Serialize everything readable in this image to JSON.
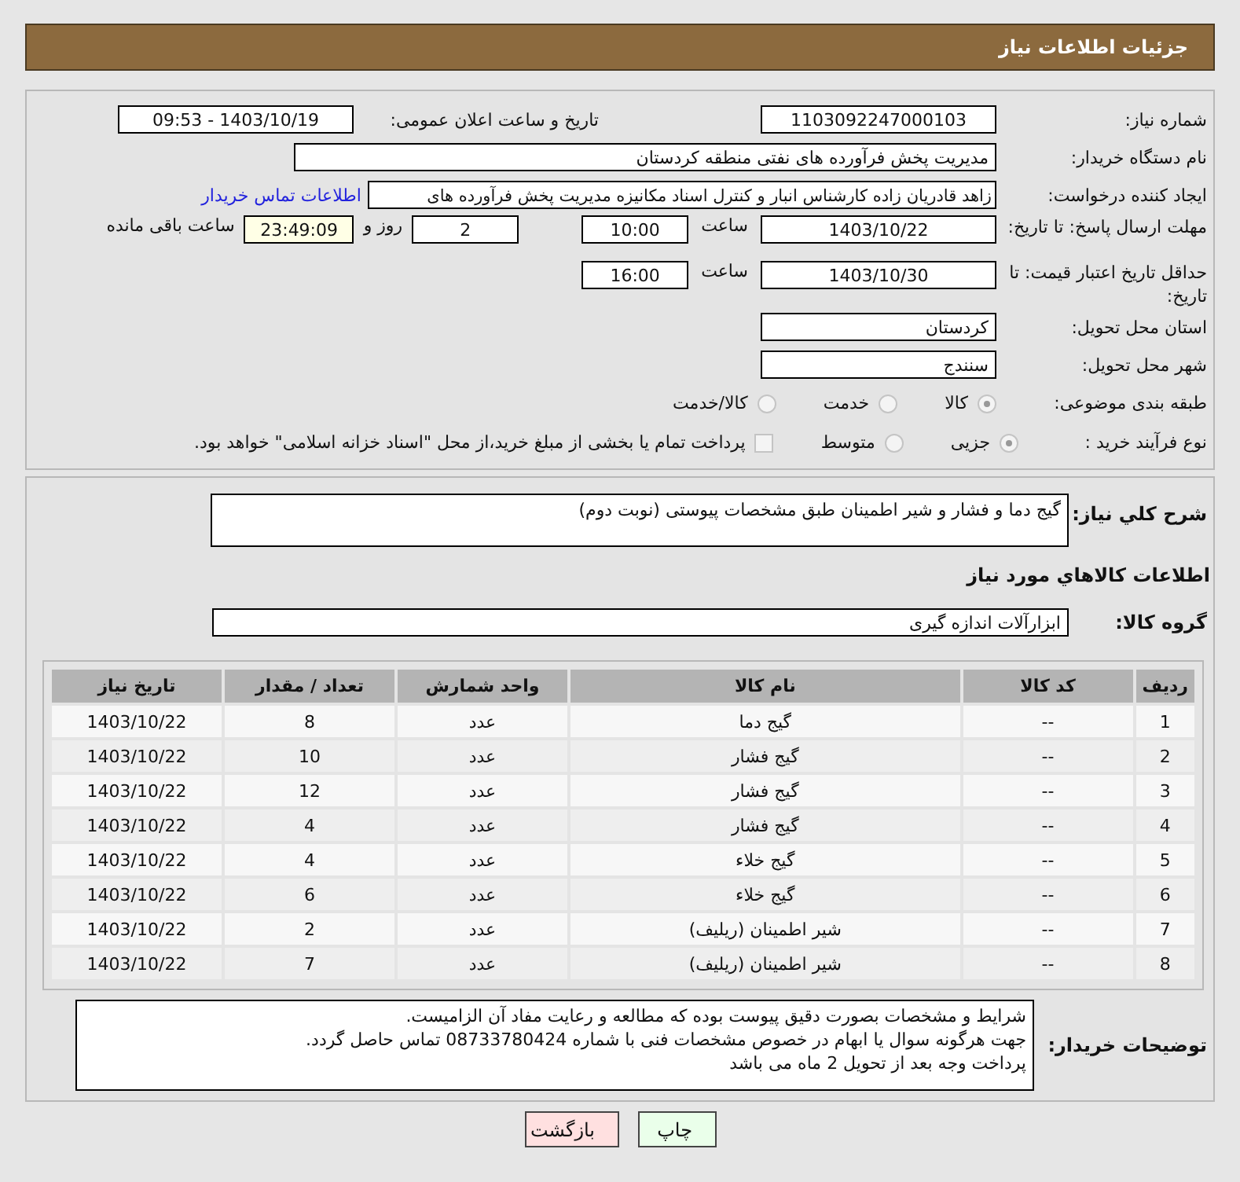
{
  "header": {
    "title": "جزئیات اطلاعات نیاز"
  },
  "need_number": {
    "label": "شماره نیاز:",
    "value": "1103092247000103"
  },
  "announce": {
    "label": "تاریخ و ساعت اعلان عمومی:",
    "value": "1403/10/19 - 09:53"
  },
  "buyer_org": {
    "label": "نام دستگاه خریدار:",
    "value": "مدیریت پخش فرآورده های نفتی منطقه کردستان"
  },
  "requester": {
    "label": "ایجاد کننده درخواست:",
    "value": "زاهد قادریان زاده کارشناس انبار و کنترل اسناد مکانیزه مدیریت پخش فرآورده های",
    "link": "اطلاعات تماس خریدار"
  },
  "reply_deadline": {
    "label": "مهلت ارسال پاسخ: تا تاریخ:",
    "date": "1403/10/22",
    "time_label": "ساعت",
    "time": "10:00",
    "days": "2",
    "days_label": "روز و",
    "remaining": "23:49:09",
    "remaining_label": "ساعت باقی مانده"
  },
  "price_validity": {
    "label": "حداقل تاریخ اعتبار قیمت: تا تاریخ:",
    "date": "1403/10/30",
    "time_label": "ساعت",
    "time": "16:00"
  },
  "province": {
    "label": "استان محل تحویل:",
    "value": "کردستان"
  },
  "city": {
    "label": "شهر محل تحویل:",
    "value": "سنندج"
  },
  "category": {
    "label": "طبقه بندی موضوعی:",
    "options": [
      {
        "label": "کالا",
        "selected": true
      },
      {
        "label": "خدمت",
        "selected": false
      },
      {
        "label": "کالا/خدمت",
        "selected": false
      }
    ]
  },
  "purchase_type": {
    "label": "نوع فرآیند خرید :",
    "options": [
      {
        "label": "جزیی",
        "selected": true
      },
      {
        "label": "متوسط",
        "selected": false
      }
    ],
    "payment": {
      "label": "پرداخت تمام یا بخشی از مبلغ خرید،از محل \"اسناد خزانه اسلامی\" خواهد بود.",
      "checked": false
    }
  },
  "description": {
    "label": "شرح کلي نياز:",
    "value": "گیج دما و فشار و شیر اطمینان طبق مشخصات پیوستی (نوبت دوم)"
  },
  "goods_title": "اطلاعات کالاهاي مورد نياز",
  "goods_group": {
    "label": "گروه کالا:",
    "value": "ابزارآلات اندازه گیری"
  },
  "table": {
    "columns": [
      "ردیف",
      "کد کالا",
      "نام کالا",
      "واحد شمارش",
      "تعداد / مقدار",
      "تاریخ نیاز"
    ],
    "rows": [
      [
        "1",
        "--",
        "گیج دما",
        "عدد",
        "8",
        "1403/10/22"
      ],
      [
        "2",
        "--",
        "گیج فشار",
        "عدد",
        "10",
        "1403/10/22"
      ],
      [
        "3",
        "--",
        "گیج فشار",
        "عدد",
        "12",
        "1403/10/22"
      ],
      [
        "4",
        "--",
        "گیج فشار",
        "عدد",
        "4",
        "1403/10/22"
      ],
      [
        "5",
        "--",
        "گیج خلاء",
        "عدد",
        "4",
        "1403/10/22"
      ],
      [
        "6",
        "--",
        "گیج خلاء",
        "عدد",
        "6",
        "1403/10/22"
      ],
      [
        "7",
        "--",
        "شیر اطمینان (ریلیف)",
        "عدد",
        "2",
        "1403/10/22"
      ],
      [
        "8",
        "--",
        "شیر اطمینان (ریلیف)",
        "عدد",
        "7",
        "1403/10/22"
      ]
    ]
  },
  "buyer_notes": {
    "label": "توضیحات خریدار:",
    "lines": [
      "شرایط و مشخصات بصورت دقیق پیوست بوده که مطالعه و رعایت مفاد آن الزامیست.",
      "جهت هرگونه سوال یا ابهام در خصوص مشخصات فنی با شماره 08733780424 تماس حاصل گردد.",
      "پرداخت وجه بعد از تحویل 2 ماه می باشد"
    ]
  },
  "buttons": [
    {
      "label": "چاپ",
      "kind": "print"
    },
    {
      "label": "بازگشت",
      "kind": "back"
    }
  ]
}
